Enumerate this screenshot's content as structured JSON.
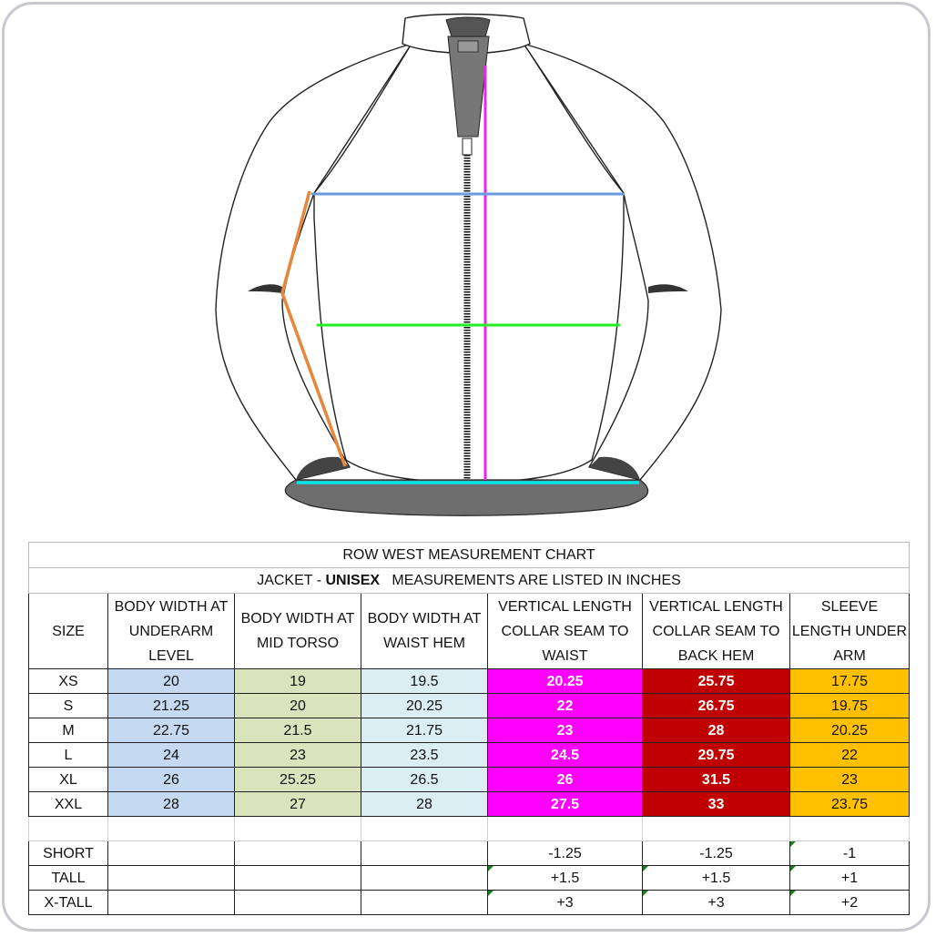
{
  "title": "ROW WEST MEASUREMENT CHART",
  "subtitle": {
    "prefix": "JACKET - ",
    "emphasis": "UNISEX",
    "suffix": "MEASUREMENTS ARE LISTED IN INCHES"
  },
  "columns": [
    "SIZE",
    "BODY WIDTH AT UNDERARM LEVEL",
    "BODY WIDTH AT MID TORSO",
    "BODY WIDTH AT WAIST HEM",
    "VERTICAL LENGTH COLLAR SEAM TO WAIST",
    "VERTICAL LENGTH COLLAR SEAM TO BACK HEM",
    "SLEEVE LENGTH UNDER ARM"
  ],
  "column_colors": [
    "#ffffff",
    "#c5d9f0",
    "#d8e4bc",
    "#daeef3",
    "#ff00ff",
    "#c00000",
    "#ffc000"
  ],
  "rows": [
    [
      "XS",
      "20",
      "19",
      "19.5",
      "20.25",
      "25.75",
      "17.75"
    ],
    [
      "S",
      "21.25",
      "20",
      "20.25",
      "22",
      "26.75",
      "19.75"
    ],
    [
      "M",
      "22.75",
      "21.5",
      "21.75",
      "23",
      "28",
      "20.25"
    ],
    [
      "L",
      "24",
      "23",
      "23.5",
      "24.5",
      "29.75",
      "22"
    ],
    [
      "XL",
      "26",
      "25.25",
      "26.5",
      "26",
      "31.5",
      "23"
    ],
    [
      "XXL",
      "28",
      "27",
      "28",
      "27.5",
      "33",
      "23.75"
    ]
  ],
  "adjustments": [
    [
      "SHORT",
      "",
      "",
      "",
      "-1.25",
      "-1.25",
      "-1"
    ],
    [
      "TALL",
      "",
      "",
      "",
      "+1.5",
      "+1.5",
      "+1"
    ],
    [
      "X-TALL",
      "",
      "",
      "",
      "+3",
      "+3",
      "+2"
    ]
  ],
  "measurement_line_colors": {
    "underarm": "#6a9be0",
    "mid_torso": "#22ee22",
    "waist_hem": "#00e5e5",
    "collar_to_hem": "#ee22ee",
    "sleeve": "#e8873a"
  }
}
